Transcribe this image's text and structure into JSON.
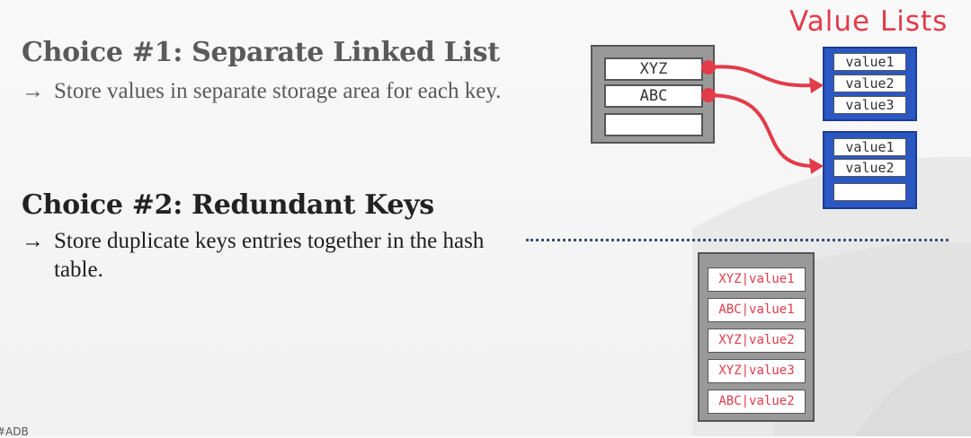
{
  "choice1": {
    "heading": "Choice #1: Separate Linked List",
    "arrow": "→",
    "bullet": "Store values in separate storage area for each key."
  },
  "choice2": {
    "heading": "Choice #2: Redundant Keys",
    "arrow": "→",
    "bullet": "Store duplicate keys entries together in the hash table."
  },
  "diagram": {
    "value_lists_title": "Value Lists",
    "hash_slots": [
      "XYZ",
      "ABC",
      ""
    ],
    "list_xyz": [
      "value1",
      "value2",
      "value3"
    ],
    "list_abc": [
      "value1",
      "value2",
      ""
    ],
    "redundant_entries": [
      "XYZ|value1",
      "ABC|value1",
      "XYZ|value2",
      "XYZ|value3",
      "ABC|value2"
    ]
  },
  "footer": "#ADB",
  "colors": {
    "accent_red": "#e23b4a",
    "list_blue": "#2a57c3",
    "divider": "#3f4d78"
  }
}
